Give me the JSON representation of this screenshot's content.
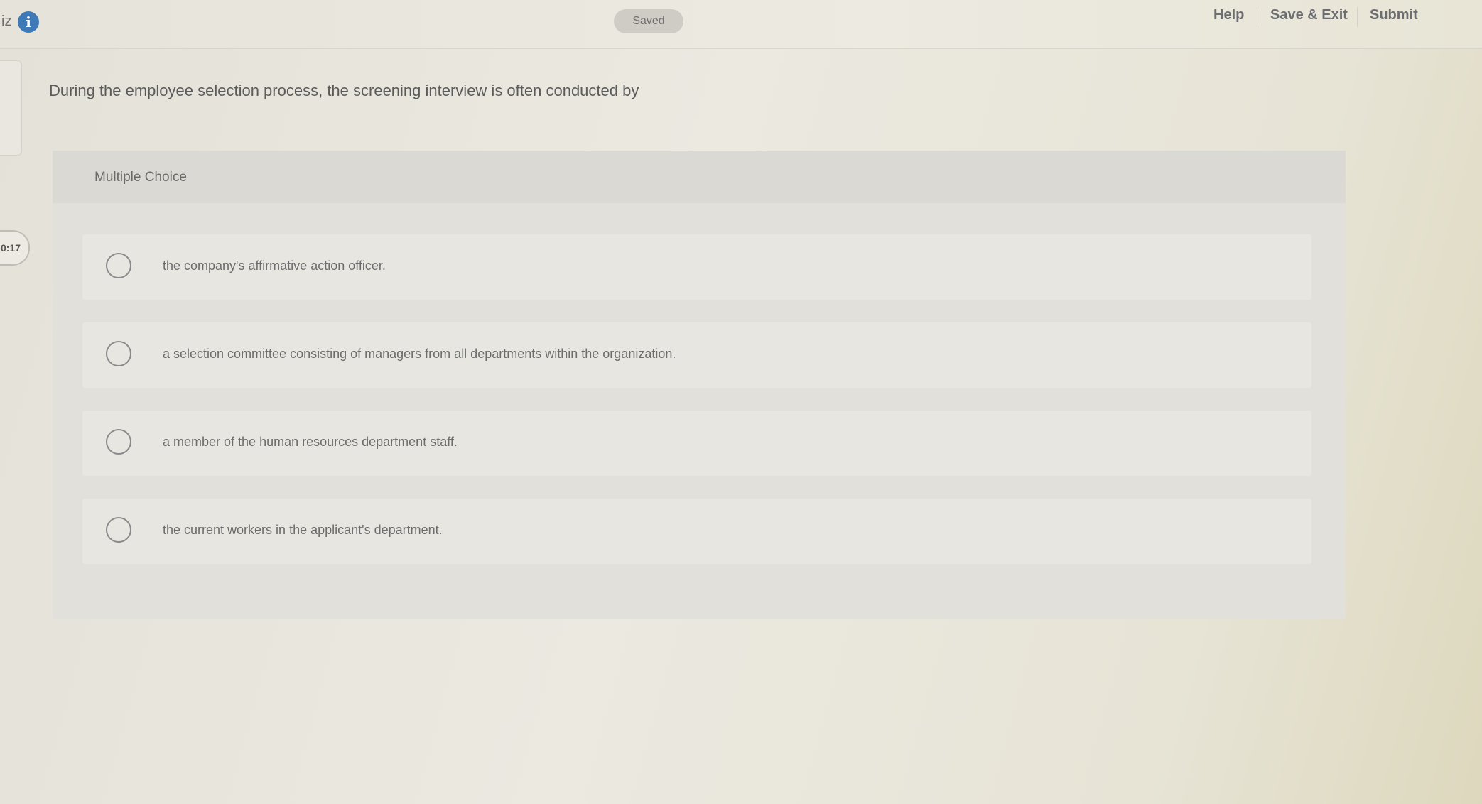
{
  "header": {
    "quiz_label": "iz",
    "info_glyph": "i",
    "saved_label": "Saved",
    "help_label": "Help",
    "save_exit_label": "Save & Exit",
    "submit_label": "Submit"
  },
  "timer": {
    "text": "0:17"
  },
  "question": {
    "text": "During the employee selection process, the screening interview is often conducted by"
  },
  "multiple_choice": {
    "label": "Multiple Choice",
    "options": [
      {
        "text": "the company's affirmative action officer."
      },
      {
        "text": "a selection committee consisting of managers from all departments within the organization."
      },
      {
        "text": "a member of the human resources department staff."
      },
      {
        "text": "the current workers in the applicant's department."
      }
    ]
  },
  "icons": {
    "info": "info-icon",
    "radio": "radio-button"
  },
  "colors": {
    "accent_blue": "#3f7ab8",
    "nav_text": "#6b6d70",
    "panel_bg": "#e1e0da"
  }
}
